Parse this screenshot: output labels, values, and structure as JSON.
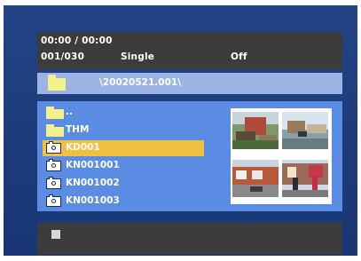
{
  "status": {
    "time": "00:00  /  00:00",
    "counter": "001/030",
    "mode": "Single",
    "setting": "Off"
  },
  "path": {
    "current": "\\20020521.001\\"
  },
  "files": [
    {
      "label": "..",
      "type": "folder-icon"
    },
    {
      "label": "THM",
      "type": "folder-icon"
    },
    {
      "label": "KD001",
      "type": "camera-file-icon",
      "selected": true
    },
    {
      "label": "KN001001",
      "type": "camera-file-icon"
    },
    {
      "label": "KN001002",
      "type": "camera-file-icon"
    },
    {
      "label": "KN001003",
      "type": "camera-file-icon"
    }
  ],
  "colors": {
    "background": "#1d3a78",
    "browser": "#5b8ce4",
    "selection": "#f0c040",
    "folder": "#f4f08a",
    "panel": "#3c3c3c"
  },
  "controls": {
    "stop_icon": "stop-icon"
  }
}
